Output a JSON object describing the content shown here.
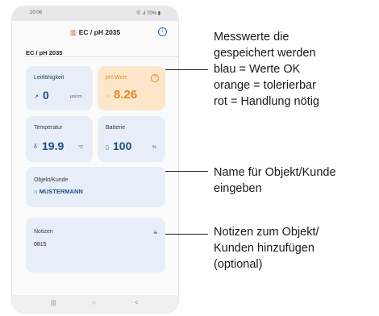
{
  "status": {
    "time": "20:06",
    "right": "© .ıl 70% ▮"
  },
  "app": {
    "title": "EC / pH 2035"
  },
  "section_title": "EC / pH 2035",
  "cards": {
    "conductivity": {
      "label": "Leitfähigkeit",
      "value": "0",
      "unit": "µs/cm"
    },
    "ph": {
      "label": "pH-Wert",
      "value": "8.26"
    },
    "temperature": {
      "label": "Temperatur",
      "value": "19.9",
      "unit": "°C"
    },
    "battery": {
      "label": "Batterie",
      "value": "100",
      "unit": "%"
    },
    "object": {
      "label": "Objekt/Kunde",
      "value": "MUSTERMANN"
    },
    "notes": {
      "label": "Notizen",
      "value": "0815"
    }
  },
  "annotations": {
    "measure": [
      "Messwerte die",
      "gespeichert werden",
      "blau = Werte OK",
      "orange = tolerierbar",
      "rot = Handlung nötig"
    ],
    "object": [
      "Name für Objekt/Kunde",
      "eingeben"
    ],
    "notes": [
      "Notizen zum Objekt/",
      "Kunden hinzufügen",
      "(optional)"
    ]
  }
}
